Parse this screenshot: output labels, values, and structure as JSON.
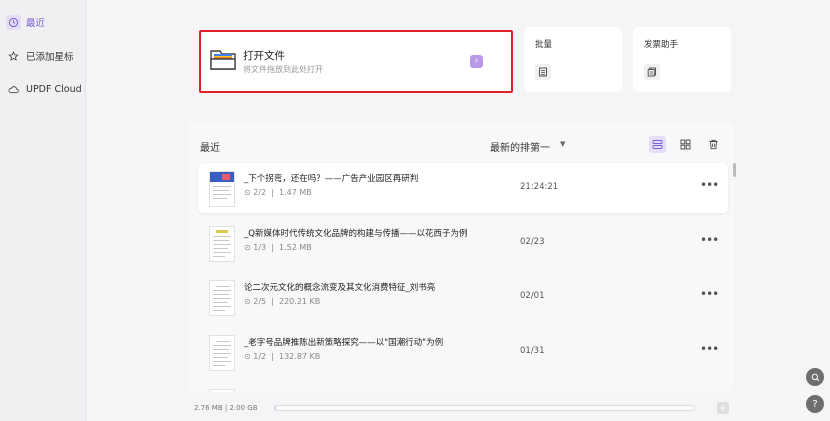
{
  "sidebar": {
    "items": [
      {
        "label": "最近",
        "icon": "clock-icon",
        "active": true
      },
      {
        "label": "已添加星标",
        "icon": "star-icon",
        "active": false
      },
      {
        "label": "UPDF Cloud",
        "icon": "cloud-icon",
        "active": false
      }
    ]
  },
  "open_card": {
    "title": "打开文件",
    "subtitle": "将文件拖放到此处打开",
    "go_icon": "chevron-right-icon"
  },
  "batch_card": {
    "title": "批量",
    "icon": "batch-icon"
  },
  "invoice_card": {
    "title": "发票助手",
    "icon": "invoice-icon"
  },
  "recent": {
    "title": "最近",
    "sort_label": "最新的排第一",
    "files": [
      {
        "name": "_下个拐弯，还在吗？——广告产业园区再研判",
        "pages": "2/2",
        "size": "1.47 MB",
        "date": "21:24:21"
      },
      {
        "name": "_Q新媒体时代传统文化品牌的构建与传播——以花西子为例",
        "pages": "1/3",
        "size": "1.52 MB",
        "date": "02/23"
      },
      {
        "name": "论二次元文化的概念流变及其文化消费特征_刘书亮",
        "pages": "2/5",
        "size": "220.21 KB",
        "date": "02/01"
      },
      {
        "name": "_老字号品牌推陈出新策略探究——以\"国潮行动\"为例",
        "pages": "1/2",
        "size": "132.87 KB",
        "date": "01/31"
      }
    ]
  },
  "footer": {
    "storage": "2.76 MB | 2.00 GB",
    "storage_used_fraction": 0.0013
  },
  "colors": {
    "accent": "#7d5cd6",
    "highlight_border": "#e0202a"
  }
}
